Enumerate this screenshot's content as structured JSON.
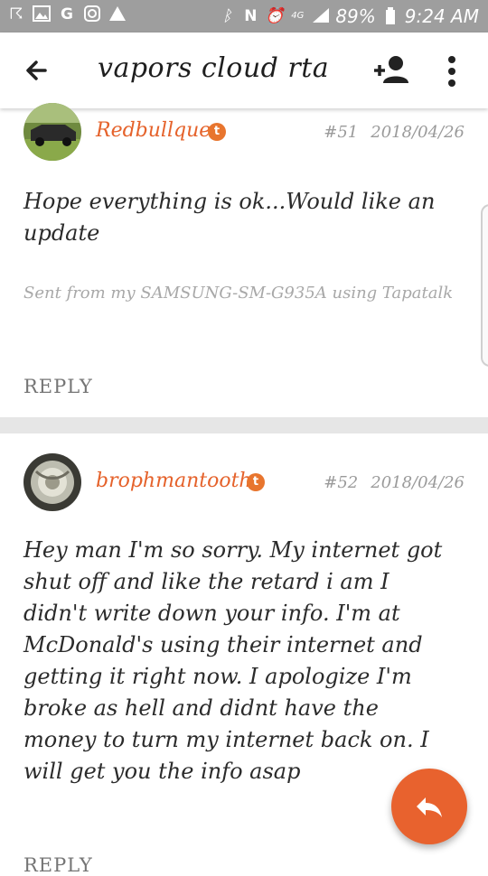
{
  "status_bar": {
    "icons": [
      "usb-icon",
      "image-icon",
      "google-icon",
      "instagram-icon",
      "warning-icon"
    ],
    "right_icons": [
      "bluetooth-icon",
      "nfc-icon",
      "alarm-icon",
      "lte-icon",
      "signal-icon"
    ],
    "battery_percent": "89%",
    "time": "9:24 AM"
  },
  "appbar": {
    "title": "vapors cloud rta",
    "back_icon": "back-arrow-icon",
    "add_user_icon": "add-user-icon",
    "more_icon": "more-vert-icon"
  },
  "posts": [
    {
      "username": "Redbullque",
      "badge": "t",
      "post_number": "#51",
      "date": "2018/04/26",
      "body": "Hope everything is ok...Would like an update",
      "signature": "Sent from my SAMSUNG-SM-G935A using Tapatalk",
      "reply_label": "REPLY"
    },
    {
      "username": "brophmantooth",
      "badge": "t",
      "post_number": "#52",
      "date": "2018/04/26",
      "body": "Hey man I'm so sorry. My internet got shut off and like the retard i am I didn't write down your info. I'm at McDonald's using their internet and getting it right now. I apologize I'm broke as hell and didnt have the money to turn my internet back on. I will get you the info asap",
      "reply_label": "REPLY"
    }
  ],
  "fab": {
    "icon": "reply-icon",
    "color": "#e8622e"
  },
  "colors": {
    "accent": "#e5622b",
    "statusbar": "#9e9e9e"
  }
}
